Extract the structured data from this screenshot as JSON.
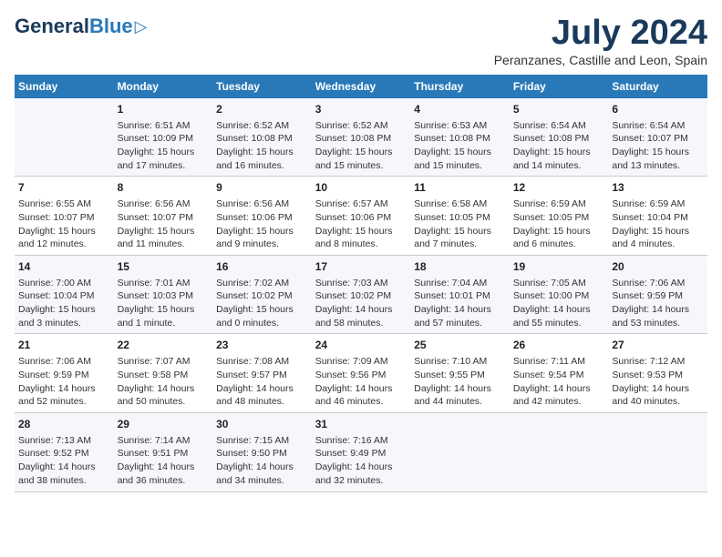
{
  "header": {
    "logo_general": "General",
    "logo_blue": "Blue",
    "month_title": "July 2024",
    "location": "Peranzanes, Castille and Leon, Spain"
  },
  "days_of_week": [
    "Sunday",
    "Monday",
    "Tuesday",
    "Wednesday",
    "Thursday",
    "Friday",
    "Saturday"
  ],
  "weeks": [
    [
      {
        "day": "",
        "info": ""
      },
      {
        "day": "1",
        "info": "Sunrise: 6:51 AM\nSunset: 10:09 PM\nDaylight: 15 hours\nand 17 minutes."
      },
      {
        "day": "2",
        "info": "Sunrise: 6:52 AM\nSunset: 10:08 PM\nDaylight: 15 hours\nand 16 minutes."
      },
      {
        "day": "3",
        "info": "Sunrise: 6:52 AM\nSunset: 10:08 PM\nDaylight: 15 hours\nand 15 minutes."
      },
      {
        "day": "4",
        "info": "Sunrise: 6:53 AM\nSunset: 10:08 PM\nDaylight: 15 hours\nand 15 minutes."
      },
      {
        "day": "5",
        "info": "Sunrise: 6:54 AM\nSunset: 10:08 PM\nDaylight: 15 hours\nand 14 minutes."
      },
      {
        "day": "6",
        "info": "Sunrise: 6:54 AM\nSunset: 10:07 PM\nDaylight: 15 hours\nand 13 minutes."
      }
    ],
    [
      {
        "day": "7",
        "info": "Sunrise: 6:55 AM\nSunset: 10:07 PM\nDaylight: 15 hours\nand 12 minutes."
      },
      {
        "day": "8",
        "info": "Sunrise: 6:56 AM\nSunset: 10:07 PM\nDaylight: 15 hours\nand 11 minutes."
      },
      {
        "day": "9",
        "info": "Sunrise: 6:56 AM\nSunset: 10:06 PM\nDaylight: 15 hours\nand 9 minutes."
      },
      {
        "day": "10",
        "info": "Sunrise: 6:57 AM\nSunset: 10:06 PM\nDaylight: 15 hours\nand 8 minutes."
      },
      {
        "day": "11",
        "info": "Sunrise: 6:58 AM\nSunset: 10:05 PM\nDaylight: 15 hours\nand 7 minutes."
      },
      {
        "day": "12",
        "info": "Sunrise: 6:59 AM\nSunset: 10:05 PM\nDaylight: 15 hours\nand 6 minutes."
      },
      {
        "day": "13",
        "info": "Sunrise: 6:59 AM\nSunset: 10:04 PM\nDaylight: 15 hours\nand 4 minutes."
      }
    ],
    [
      {
        "day": "14",
        "info": "Sunrise: 7:00 AM\nSunset: 10:04 PM\nDaylight: 15 hours\nand 3 minutes."
      },
      {
        "day": "15",
        "info": "Sunrise: 7:01 AM\nSunset: 10:03 PM\nDaylight: 15 hours\nand 1 minute."
      },
      {
        "day": "16",
        "info": "Sunrise: 7:02 AM\nSunset: 10:02 PM\nDaylight: 15 hours\nand 0 minutes."
      },
      {
        "day": "17",
        "info": "Sunrise: 7:03 AM\nSunset: 10:02 PM\nDaylight: 14 hours\nand 58 minutes."
      },
      {
        "day": "18",
        "info": "Sunrise: 7:04 AM\nSunset: 10:01 PM\nDaylight: 14 hours\nand 57 minutes."
      },
      {
        "day": "19",
        "info": "Sunrise: 7:05 AM\nSunset: 10:00 PM\nDaylight: 14 hours\nand 55 minutes."
      },
      {
        "day": "20",
        "info": "Sunrise: 7:06 AM\nSunset: 9:59 PM\nDaylight: 14 hours\nand 53 minutes."
      }
    ],
    [
      {
        "day": "21",
        "info": "Sunrise: 7:06 AM\nSunset: 9:59 PM\nDaylight: 14 hours\nand 52 minutes."
      },
      {
        "day": "22",
        "info": "Sunrise: 7:07 AM\nSunset: 9:58 PM\nDaylight: 14 hours\nand 50 minutes."
      },
      {
        "day": "23",
        "info": "Sunrise: 7:08 AM\nSunset: 9:57 PM\nDaylight: 14 hours\nand 48 minutes."
      },
      {
        "day": "24",
        "info": "Sunrise: 7:09 AM\nSunset: 9:56 PM\nDaylight: 14 hours\nand 46 minutes."
      },
      {
        "day": "25",
        "info": "Sunrise: 7:10 AM\nSunset: 9:55 PM\nDaylight: 14 hours\nand 44 minutes."
      },
      {
        "day": "26",
        "info": "Sunrise: 7:11 AM\nSunset: 9:54 PM\nDaylight: 14 hours\nand 42 minutes."
      },
      {
        "day": "27",
        "info": "Sunrise: 7:12 AM\nSunset: 9:53 PM\nDaylight: 14 hours\nand 40 minutes."
      }
    ],
    [
      {
        "day": "28",
        "info": "Sunrise: 7:13 AM\nSunset: 9:52 PM\nDaylight: 14 hours\nand 38 minutes."
      },
      {
        "day": "29",
        "info": "Sunrise: 7:14 AM\nSunset: 9:51 PM\nDaylight: 14 hours\nand 36 minutes."
      },
      {
        "day": "30",
        "info": "Sunrise: 7:15 AM\nSunset: 9:50 PM\nDaylight: 14 hours\nand 34 minutes."
      },
      {
        "day": "31",
        "info": "Sunrise: 7:16 AM\nSunset: 9:49 PM\nDaylight: 14 hours\nand 32 minutes."
      },
      {
        "day": "",
        "info": ""
      },
      {
        "day": "",
        "info": ""
      },
      {
        "day": "",
        "info": ""
      }
    ]
  ]
}
